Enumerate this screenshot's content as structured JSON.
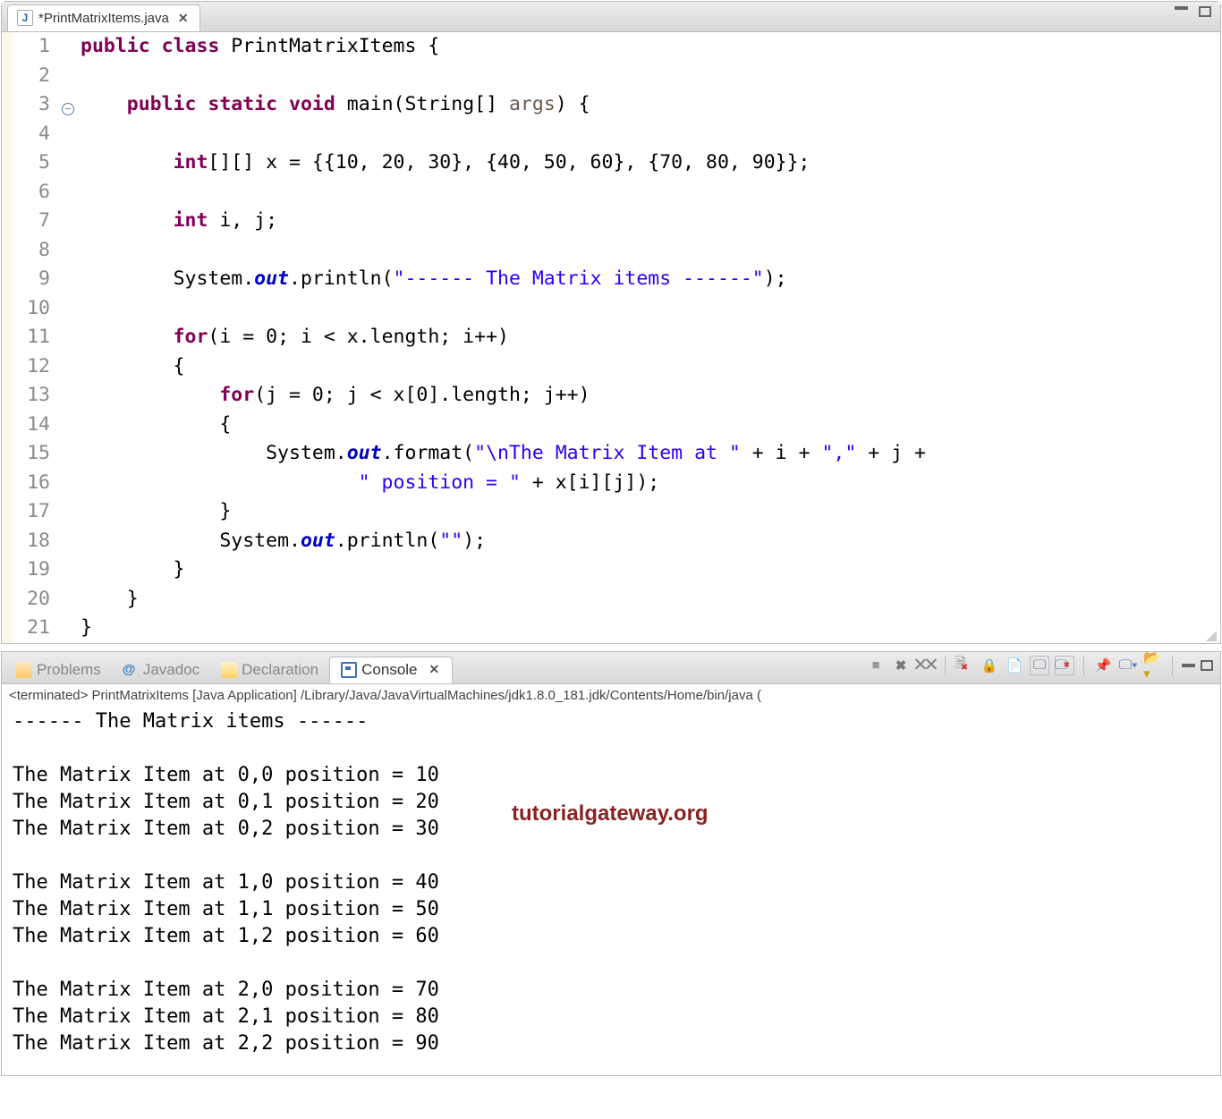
{
  "editor": {
    "tab_label": "*PrintMatrixItems.java"
  },
  "code": {
    "l1": {
      "a": "public",
      "b": "class",
      "c": " PrintMatrixItems {"
    },
    "l3": {
      "a": "public",
      "b": "static",
      "c": "void",
      "d": " main(String[] ",
      "arg": "args",
      "e": ") {"
    },
    "l5": {
      "a": "int",
      "b": "[][] x = {{10, 20, 30}, {40, 50, 60}, {70, 80, 90}};"
    },
    "l7": {
      "a": "int",
      "b": " i, j;"
    },
    "l9": {
      "a": "System.",
      "b": "out",
      "c": ".println(",
      "s": "\"------ The Matrix items ------\"",
      "d": ");"
    },
    "l11": {
      "a": "for",
      "b": "(i = 0; i < x.length; i++)"
    },
    "l12": "        {",
    "l13": {
      "a": "for",
      "b": "(j = 0; j < x[0].length; j++)"
    },
    "l14": "            {",
    "l15": {
      "a": "System.",
      "b": "out",
      "c": ".format(",
      "s": "\"\\nThe Matrix Item at \"",
      "d": " + i + ",
      "s2": "\",\"",
      "e": " + j +"
    },
    "l16": {
      "s": "\" position = \"",
      "a": " + x[i][j]);"
    },
    "l17": "            }",
    "l18": {
      "a": "System.",
      "b": "out",
      "c": ".println(",
      "s": "\"\"",
      "d": ");"
    },
    "l19": "        }",
    "l20": "    }",
    "l21": "}"
  },
  "line_numbers": [
    "1",
    "2",
    "3",
    "4",
    "5",
    "6",
    "7",
    "8",
    "9",
    "10",
    "11",
    "12",
    "13",
    "14",
    "15",
    "16",
    "17",
    "18",
    "19",
    "20",
    "21"
  ],
  "console": {
    "tabs": {
      "problems": "Problems",
      "javadoc": "Javadoc",
      "declaration": "Declaration",
      "console": "Console"
    },
    "status": "<terminated> PrintMatrixItems [Java Application] /Library/Java/JavaVirtualMachines/jdk1.8.0_181.jdk/Contents/Home/bin/java  (",
    "output": "------ The Matrix items ------\n\nThe Matrix Item at 0,0 position = 10\nThe Matrix Item at 0,1 position = 20\nThe Matrix Item at 0,2 position = 30\n\nThe Matrix Item at 1,0 position = 40\nThe Matrix Item at 1,1 position = 50\nThe Matrix Item at 1,2 position = 60\n\nThe Matrix Item at 2,0 position = 70\nThe Matrix Item at 2,1 position = 80\nThe Matrix Item at 2,2 position = 90"
  },
  "watermark": "tutorialgateway.org",
  "tab_close_glyph": "✕"
}
